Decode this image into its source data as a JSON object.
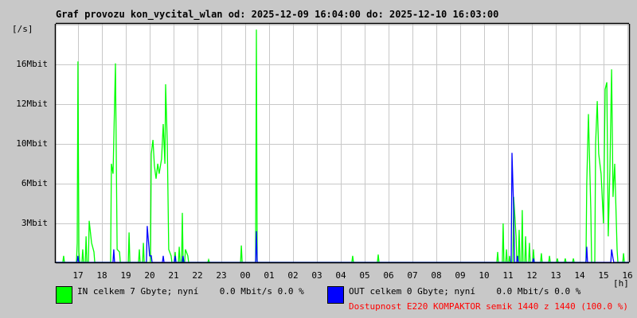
{
  "title": "Graf provozu kon_vycital_wlan od: 2025-12-09 16:04:00 do: 2025-12-10 16:03:00",
  "chart_data": {
    "type": "line",
    "title": "Graf provozu kon_vycital_wlan od: 2025-12-09 16:04:00 do: 2025-12-10 16:03:00",
    "ylabel": "[/s]",
    "xlabel": "[h]",
    "x_unit": "hours since 2025-12-09 16:04",
    "xlim": [
      0,
      24
    ],
    "y_ticks": [
      {
        "value": 3,
        "label": "3Mbit"
      },
      {
        "value": 6,
        "label": "6Mbit"
      },
      {
        "value": 10,
        "label": "10Mbit"
      },
      {
        "value": 12,
        "label": "12Mbit"
      },
      {
        "value": 16,
        "label": "16Mbit"
      }
    ],
    "y_top": 20,
    "x_ticks": [
      "17",
      "18",
      "19",
      "20",
      "21",
      "22",
      "23",
      "00",
      "01",
      "02",
      "03",
      "04",
      "05",
      "06",
      "07",
      "08",
      "09",
      "10",
      "11",
      "12",
      "13",
      "14",
      "15",
      "16"
    ],
    "grid": true,
    "series": [
      {
        "name": "IN",
        "color": "#00ff00",
        "points": [
          [
            0.33,
            0.5
          ],
          [
            0.9,
            1.5
          ],
          [
            0.93,
            16.3
          ],
          [
            0.97,
            0.8
          ],
          [
            1.13,
            1
          ],
          [
            1.27,
            2
          ],
          [
            1.4,
            3.2
          ],
          [
            1.5,
            1.5
          ],
          [
            1.6,
            0.8
          ],
          [
            2.33,
            8
          ],
          [
            2.4,
            7
          ],
          [
            2.5,
            16.1
          ],
          [
            2.57,
            1
          ],
          [
            2.67,
            0.8
          ],
          [
            3.07,
            2.3
          ],
          [
            3.5,
            1
          ],
          [
            3.67,
            1.5
          ],
          [
            4.0,
            9
          ],
          [
            4.07,
            10.2
          ],
          [
            4.13,
            7.8
          ],
          [
            4.2,
            6.5
          ],
          [
            4.27,
            8
          ],
          [
            4.33,
            7
          ],
          [
            4.43,
            8.5
          ],
          [
            4.5,
            11
          ],
          [
            4.57,
            8
          ],
          [
            4.6,
            14
          ],
          [
            4.67,
            10
          ],
          [
            4.73,
            1
          ],
          [
            4.83,
            0.5
          ],
          [
            5.0,
            0.8
          ],
          [
            5.17,
            1.2
          ],
          [
            5.3,
            3.8
          ],
          [
            5.43,
            1
          ],
          [
            5.53,
            0.5
          ],
          [
            6.4,
            0.2
          ],
          [
            7.77,
            1.3
          ],
          [
            8.4,
            19.5
          ],
          [
            12.43,
            0.5
          ],
          [
            13.5,
            0.6
          ],
          [
            18.5,
            0.8
          ],
          [
            18.73,
            3
          ],
          [
            18.87,
            1
          ],
          [
            19.0,
            0.5
          ],
          [
            19.17,
            5
          ],
          [
            19.27,
            2
          ],
          [
            19.4,
            2.5
          ],
          [
            19.53,
            4
          ],
          [
            19.67,
            2
          ],
          [
            19.83,
            1.5
          ],
          [
            20.0,
            1
          ],
          [
            20.33,
            0.7
          ],
          [
            20.67,
            0.5
          ],
          [
            21.0,
            0.3
          ],
          [
            21.33,
            0.3
          ],
          [
            21.67,
            0.3
          ],
          [
            22.23,
            6
          ],
          [
            22.3,
            11.5
          ],
          [
            22.4,
            4
          ],
          [
            22.6,
            10
          ],
          [
            22.67,
            12.3
          ],
          [
            22.73,
            9
          ],
          [
            22.83,
            7
          ],
          [
            22.93,
            3
          ],
          [
            23.0,
            13.5
          ],
          [
            23.07,
            14.2
          ],
          [
            23.13,
            2
          ],
          [
            23.2,
            7.5
          ],
          [
            23.27,
            15.5
          ],
          [
            23.33,
            5
          ],
          [
            23.4,
            8
          ],
          [
            23.5,
            1
          ],
          [
            23.77,
            0.7
          ]
        ]
      },
      {
        "name": "OUT",
        "color": "#0000ff",
        "points": [
          [
            0.93,
            0.5
          ],
          [
            2.43,
            1
          ],
          [
            3.83,
            2.8
          ],
          [
            3.93,
            0.5
          ],
          [
            4.0,
            0.5
          ],
          [
            4.5,
            0.5
          ],
          [
            5.0,
            0.5
          ],
          [
            5.33,
            0.5
          ],
          [
            8.4,
            2.4
          ],
          [
            19.1,
            9.1
          ],
          [
            19.17,
            4
          ],
          [
            19.33,
            0.5
          ],
          [
            20.0,
            0.3
          ],
          [
            22.23,
            1.2
          ],
          [
            23.27,
            1
          ],
          [
            23.33,
            0.3
          ]
        ]
      }
    ]
  },
  "legend": {
    "in_text": "IN celkem 7 Gbyte; nyní    0.0 Mbit/s 0.0 %",
    "out_text": "OUT celkem 0 Gbyte; nyní    0.0 Mbit/s 0.0 %",
    "availability": "Dostupnost E220 KOMPAKTOR semik 1440 z 1440 (100.0 %)",
    "in_color": "#00ff00",
    "out_color": "#0000ff",
    "availability_color": "#ff0000"
  }
}
